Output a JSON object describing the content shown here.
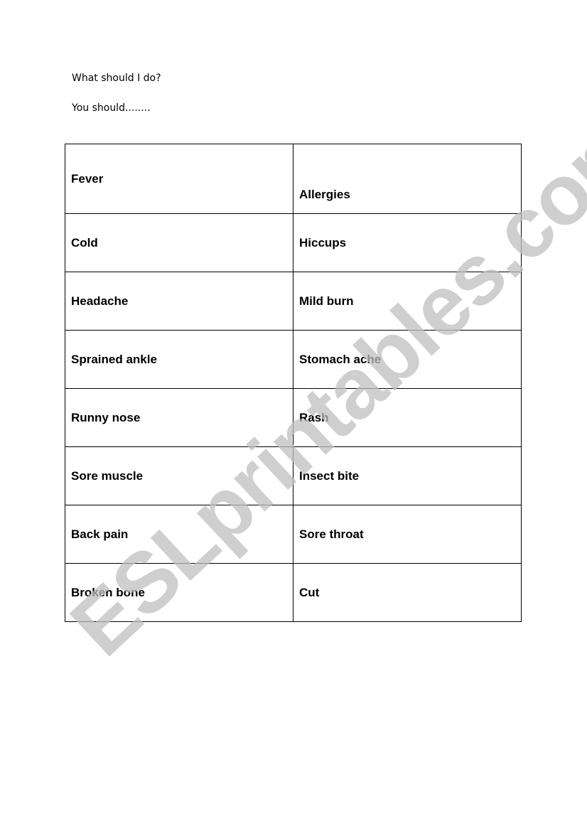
{
  "document": {
    "line1": "What should I do?",
    "line2": "You should........",
    "rows": [
      [
        "Fever",
        "Allergies"
      ],
      [
        "Cold",
        "Hiccups"
      ],
      [
        "Headache",
        "Mild burn"
      ],
      [
        "Sprained ankle",
        "Stomach ache"
      ],
      [
        "Runny nose",
        "Rash"
      ],
      [
        "Sore muscle",
        "Insect bite"
      ],
      [
        "Back pain",
        "Sore throat"
      ],
      [
        "Broken bone",
        "Cut"
      ]
    ],
    "watermark": "ESLprintables.com"
  }
}
